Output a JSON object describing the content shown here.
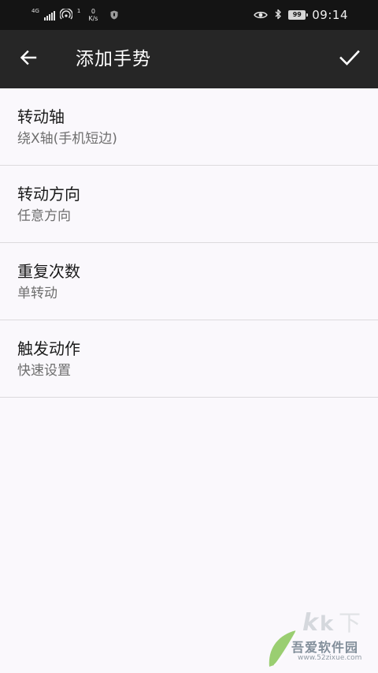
{
  "status_bar": {
    "network_type": "4G",
    "data_activity": "1",
    "speed_value": "0",
    "speed_unit": "K/s",
    "battery_level": "99",
    "time": "09:14"
  },
  "app_bar": {
    "title": "添加手势",
    "back_icon": "arrow-left-icon",
    "confirm_icon": "check-icon"
  },
  "settings": [
    {
      "title": "转动轴",
      "value": "绕X轴(手机短边)"
    },
    {
      "title": "转动方向",
      "value": "任意方向"
    },
    {
      "title": "重复次数",
      "value": "单转动"
    },
    {
      "title": "触发动作",
      "value": "快速设置"
    }
  ],
  "watermark": {
    "brand": "吾爱软件园",
    "url": "www.52zixue.com"
  },
  "colors": {
    "status_bar_bg": "#141414",
    "app_bar_bg": "#262626",
    "page_bg": "#faf8fc",
    "divider": "#dcdadd",
    "primary_text": "#1a1a1a",
    "secondary_text": "#6e6e6e"
  }
}
